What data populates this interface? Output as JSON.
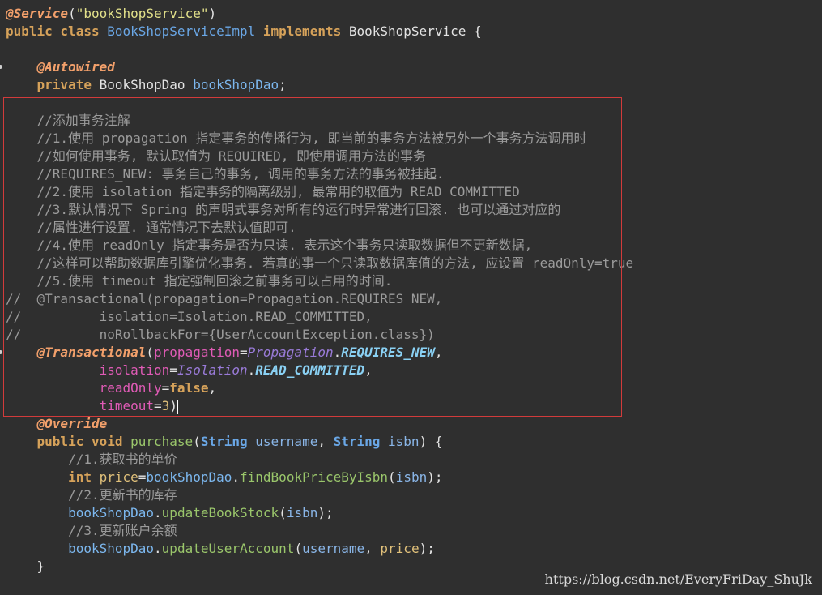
{
  "watermark": "https://blog.csdn.net/EveryFriDay_ShuJk",
  "code_lines": [
    [
      {
        "t": "@Service",
        "c": "ann"
      },
      {
        "t": "(",
        "c": "plain"
      },
      {
        "t": "\"bookShopService\"",
        "c": "str"
      },
      {
        "t": ")",
        "c": "plain"
      }
    ],
    [
      {
        "t": "public class ",
        "c": "kw"
      },
      {
        "t": "BookShopServiceImpl ",
        "c": "type"
      },
      {
        "t": "implements ",
        "c": "kw"
      },
      {
        "t": "BookShopService {",
        "c": "plain"
      }
    ],
    [],
    [
      {
        "t": "    "
      },
      {
        "t": "@Autowired",
        "c": "ann"
      }
    ],
    [
      {
        "t": "    "
      },
      {
        "t": "private ",
        "c": "kw"
      },
      {
        "t": "BookShopDao ",
        "c": "plain"
      },
      {
        "t": "bookShopDao",
        "c": "field"
      },
      {
        "t": ";",
        "c": "plain"
      }
    ],
    [],
    [
      {
        "t": "    //添加事务注解",
        "c": "cmt"
      }
    ],
    [
      {
        "t": "    //1.使用 propagation 指定事务的传播行为, 即当前的事务方法被另外一个事务方法调用时",
        "c": "cmt"
      }
    ],
    [
      {
        "t": "    //如何使用事务, 默认取值为 REQUIRED, 即使用调用方法的事务",
        "c": "cmt"
      }
    ],
    [
      {
        "t": "    //REQUIRES_NEW: 事务自己的事务, 调用的事务方法的事务被挂起.",
        "c": "cmt"
      }
    ],
    [
      {
        "t": "    //2.使用 isolation 指定事务的隔离级别, 最常用的取值为 READ_COMMITTED",
        "c": "cmt"
      }
    ],
    [
      {
        "t": "    //3.默认情况下 Spring 的声明式事务对所有的运行时异常进行回滚. 也可以通过对应的",
        "c": "cmt"
      }
    ],
    [
      {
        "t": "    //属性进行设置. 通常情况下去默认值即可.",
        "c": "cmt"
      }
    ],
    [
      {
        "t": "    //4.使用 readOnly 指定事务是否为只读. 表示这个事务只读取数据但不更新数据,",
        "c": "cmt"
      }
    ],
    [
      {
        "t": "    //这样可以帮助数据库引擎优化事务. 若真的事一个只读取数据库值的方法, 应设置 readOnly=true",
        "c": "cmt"
      }
    ],
    [
      {
        "t": "    //5.使用 timeout 指定强制回滚之前事务可以占用的时间.",
        "c": "cmt"
      }
    ],
    [
      {
        "t": "//  @Transactional(propagation=Propagation.REQUIRES_NEW,",
        "c": "cmt"
      }
    ],
    [
      {
        "t": "//          isolation=Isolation.READ_COMMITTED,",
        "c": "cmt"
      }
    ],
    [
      {
        "t": "//          noRollbackFor={UserAccountException.class})",
        "c": "cmt"
      }
    ],
    [
      {
        "t": "    "
      },
      {
        "t": "@Transactional",
        "c": "ann"
      },
      {
        "t": "(",
        "c": "plain"
      },
      {
        "t": "propagation",
        "c": "attr"
      },
      {
        "t": "=",
        "c": "plain"
      },
      {
        "t": "Propagation",
        "c": "enum"
      },
      {
        "t": ".",
        "c": "plain"
      },
      {
        "t": "REQUIRES_NEW",
        "c": "const"
      },
      {
        "t": ",",
        "c": "plain"
      }
    ],
    [
      {
        "t": "            "
      },
      {
        "t": "isolation",
        "c": "attr"
      },
      {
        "t": "=",
        "c": "plain"
      },
      {
        "t": "Isolation",
        "c": "enum"
      },
      {
        "t": ".",
        "c": "plain"
      },
      {
        "t": "READ_COMMITTED",
        "c": "const"
      },
      {
        "t": ",",
        "c": "plain"
      }
    ],
    [
      {
        "t": "            "
      },
      {
        "t": "readOnly",
        "c": "attr"
      },
      {
        "t": "=",
        "c": "plain"
      },
      {
        "t": "false",
        "c": "kw"
      },
      {
        "t": ",",
        "c": "plain"
      }
    ],
    [
      {
        "t": "            "
      },
      {
        "t": "timeout",
        "c": "attr"
      },
      {
        "t": "=",
        "c": "plain"
      },
      {
        "t": "3",
        "c": "num"
      },
      {
        "t": ")",
        "c": "plain"
      }
    ],
    [
      {
        "t": "    "
      },
      {
        "t": "@Override",
        "c": "ann"
      }
    ],
    [
      {
        "t": "    "
      },
      {
        "t": "public void ",
        "c": "kw"
      },
      {
        "t": "purchase",
        "c": "method"
      },
      {
        "t": "(",
        "c": "plain"
      },
      {
        "t": "String ",
        "c": "type-b"
      },
      {
        "t": "username",
        "c": "var"
      },
      {
        "t": ", ",
        "c": "plain"
      },
      {
        "t": "String ",
        "c": "type-b"
      },
      {
        "t": "isbn",
        "c": "var"
      },
      {
        "t": ") {",
        "c": "plain"
      }
    ],
    [
      {
        "t": "        //1.获取书的单价",
        "c": "cmt"
      }
    ],
    [
      {
        "t": "        "
      },
      {
        "t": "int ",
        "c": "kw"
      },
      {
        "t": "price",
        "c": "local"
      },
      {
        "t": "=",
        "c": "plain"
      },
      {
        "t": "bookShopDao",
        "c": "field"
      },
      {
        "t": ".",
        "c": "plain"
      },
      {
        "t": "findBookPriceByIsbn",
        "c": "method"
      },
      {
        "t": "(",
        "c": "plain"
      },
      {
        "t": "isbn",
        "c": "var"
      },
      {
        "t": ");",
        "c": "plain"
      }
    ],
    [
      {
        "t": "        //2.更新书的库存",
        "c": "cmt"
      }
    ],
    [
      {
        "t": "        "
      },
      {
        "t": "bookShopDao",
        "c": "field"
      },
      {
        "t": ".",
        "c": "plain"
      },
      {
        "t": "updateBookStock",
        "c": "method"
      },
      {
        "t": "(",
        "c": "plain"
      },
      {
        "t": "isbn",
        "c": "var"
      },
      {
        "t": ");",
        "c": "plain"
      }
    ],
    [
      {
        "t": "        //3.更新账户余额",
        "c": "cmt"
      }
    ],
    [
      {
        "t": "        "
      },
      {
        "t": "bookShopDao",
        "c": "field"
      },
      {
        "t": ".",
        "c": "plain"
      },
      {
        "t": "updateUserAccount",
        "c": "method"
      },
      {
        "t": "(",
        "c": "plain"
      },
      {
        "t": "username",
        "c": "var"
      },
      {
        "t": ", ",
        "c": "plain"
      },
      {
        "t": "price",
        "c": "local"
      },
      {
        "t": ");",
        "c": "plain"
      }
    ],
    [
      {
        "t": "    }",
        "c": "plain"
      }
    ]
  ]
}
